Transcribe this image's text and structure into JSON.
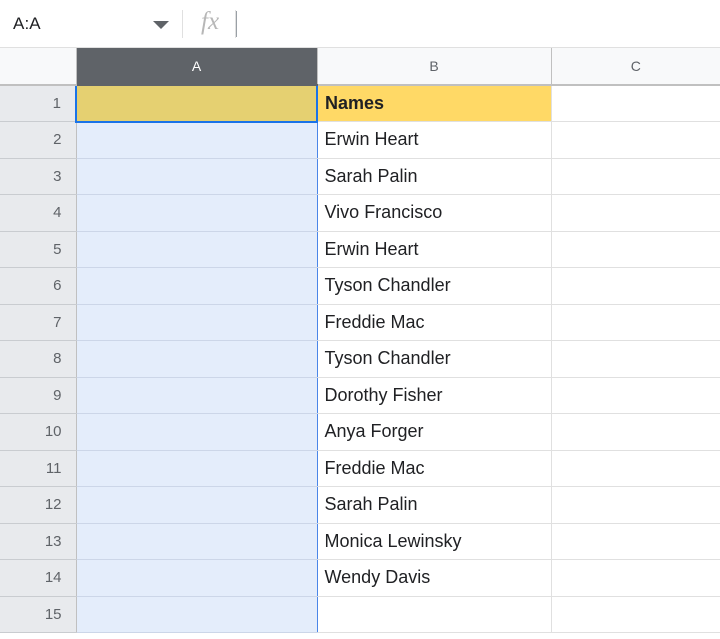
{
  "formula_bar": {
    "name_box_value": "A:A",
    "name_box_dropdown_icon": "chevron-down-icon",
    "fx_label": "fx",
    "formula_value": ""
  },
  "grid": {
    "columns": [
      {
        "label": "A",
        "selected": true
      },
      {
        "label": "B",
        "selected": false
      },
      {
        "label": "C",
        "selected": false
      }
    ],
    "rows": [
      {
        "number": "1",
        "a": "",
        "b": "Names",
        "c": ""
      },
      {
        "number": "2",
        "a": "",
        "b": "Erwin Heart",
        "c": ""
      },
      {
        "number": "3",
        "a": "",
        "b": "Sarah Palin",
        "c": ""
      },
      {
        "number": "4",
        "a": "",
        "b": "Vivo Francisco",
        "c": ""
      },
      {
        "number": "5",
        "a": "",
        "b": "Erwin Heart",
        "c": ""
      },
      {
        "number": "6",
        "a": "",
        "b": "Tyson Chandler",
        "c": ""
      },
      {
        "number": "7",
        "a": "",
        "b": "Freddie Mac",
        "c": ""
      },
      {
        "number": "8",
        "a": "",
        "b": "Tyson Chandler",
        "c": ""
      },
      {
        "number": "9",
        "a": "",
        "b": "Dorothy Fisher",
        "c": ""
      },
      {
        "number": "10",
        "a": "",
        "b": "Anya Forger",
        "c": ""
      },
      {
        "number": "11",
        "a": "",
        "b": "Freddie Mac",
        "c": ""
      },
      {
        "number": "12",
        "a": "",
        "b": "Sarah Palin",
        "c": ""
      },
      {
        "number": "13",
        "a": "",
        "b": "Monica Lewinsky",
        "c": ""
      },
      {
        "number": "14",
        "a": "",
        "b": "Wendy Davis",
        "c": ""
      },
      {
        "number": "15",
        "a": "",
        "b": "",
        "c": ""
      }
    ],
    "active_cell": "A1",
    "selected_range": "A:A",
    "colors": {
      "header_yellow": "#ffd966",
      "selected_column_tint": "#e4edfb",
      "selection_border": "#1a73e8",
      "column_header_selected": "#5f6368"
    }
  }
}
